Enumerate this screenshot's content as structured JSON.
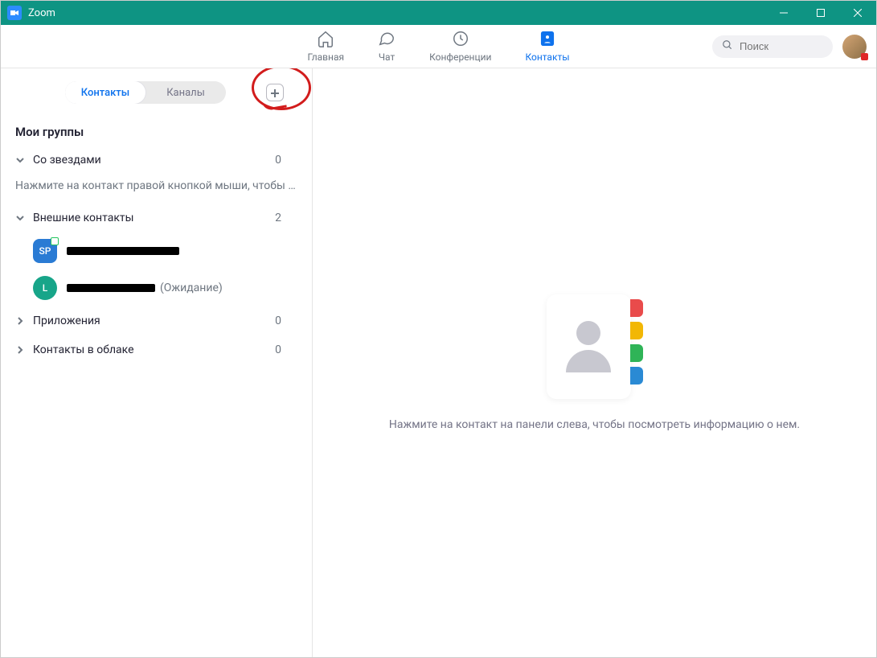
{
  "window": {
    "title": "Zoom"
  },
  "nav": {
    "home": "Главная",
    "chat": "Чат",
    "meetings": "Конференции",
    "contacts": "Контакты"
  },
  "search": {
    "placeholder": "Поиск"
  },
  "sidebar": {
    "tabs": {
      "contacts": "Контакты",
      "channels": "Каналы"
    },
    "heading": "Мои группы",
    "hint": "Нажмите на контакт правой кнопкой мыши, чтобы …",
    "groups": {
      "starred": {
        "label": "Со звездами",
        "count": "0",
        "expanded": true
      },
      "external": {
        "label": "Внешние контакты",
        "count": "2",
        "expanded": true
      },
      "apps": {
        "label": "Приложения",
        "count": "0",
        "expanded": false
      },
      "cloud": {
        "label": "Контакты в облаке",
        "count": "0",
        "expanded": false
      }
    },
    "contacts": [
      {
        "initials": "SP",
        "color": "#2a7bd4",
        "shape": "square",
        "name_redacted": true,
        "pending": ""
      },
      {
        "initials": "L",
        "color": "#17a589",
        "shape": "round",
        "name_redacted": true,
        "pending": "(Ожидание)"
      }
    ]
  },
  "detail": {
    "empty_text": "Нажмите на контакт на панели слева, чтобы посмотреть информацию о нем.",
    "tab_colors": [
      "#e94b4b",
      "#f2b705",
      "#2fb457",
      "#2a8ad4"
    ]
  }
}
